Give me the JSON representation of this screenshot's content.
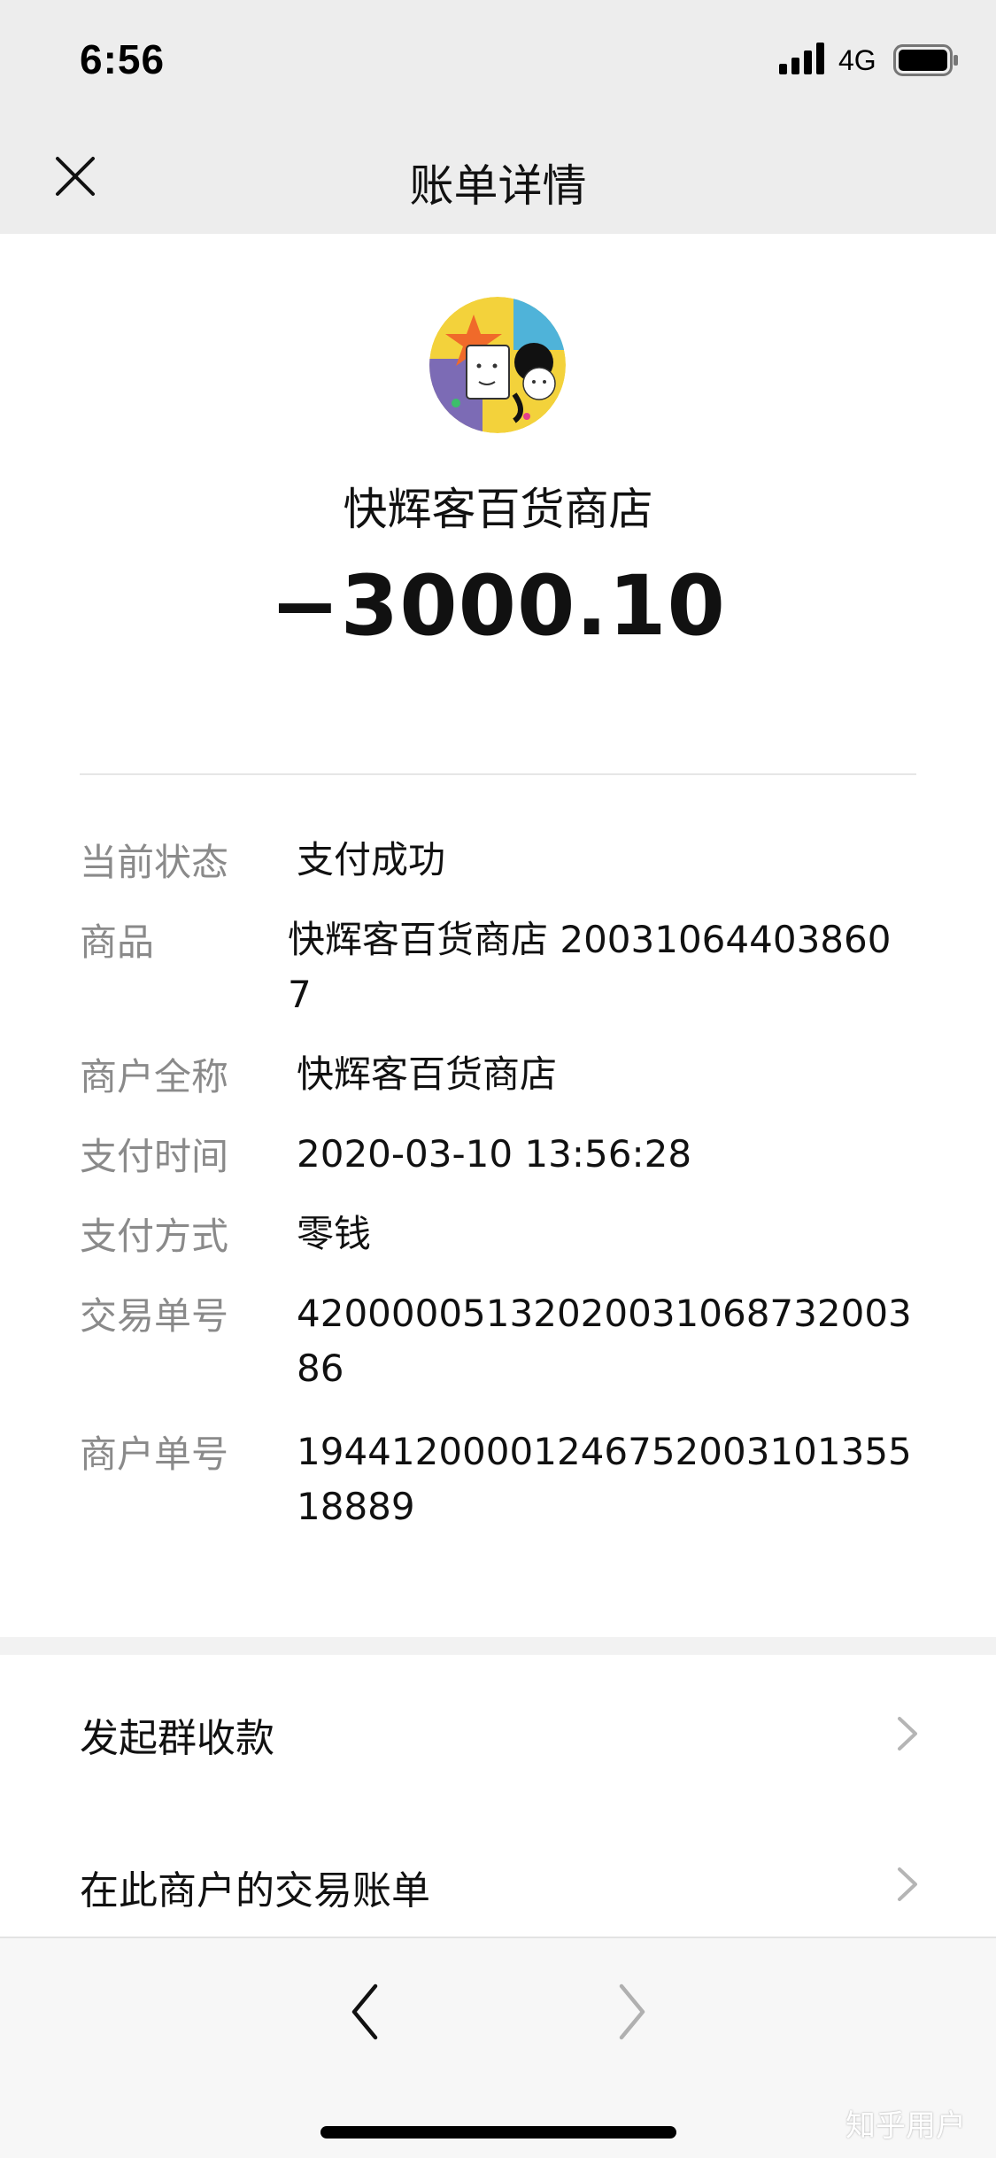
{
  "status_bar": {
    "time": "6:56",
    "network": "4G"
  },
  "nav": {
    "title": "账单详情",
    "close_icon": "close-icon"
  },
  "header": {
    "merchant_name": "快辉客百货商店",
    "amount": "−3000.10"
  },
  "details": [
    {
      "label": "当前状态",
      "value": "支付成功"
    },
    {
      "label": "商品",
      "value": "快辉客百货商店 200310644038607"
    },
    {
      "label": "商户全称",
      "value": "快辉客百货商店"
    },
    {
      "label": "支付时间",
      "value": "2020-03-10 13:56:28"
    },
    {
      "label": "支付方式",
      "value": "零钱"
    },
    {
      "label": "交易单号",
      "value": "4200000513202003106873200386"
    },
    {
      "label": "商户单号",
      "value": "1944120000124675200310135518889"
    }
  ],
  "actions": [
    {
      "label": "发起群收款"
    },
    {
      "label": "在此商户的交易账单"
    }
  ],
  "toolbar": {
    "back_icon": "chevron-left-icon",
    "forward_icon": "chevron-right-icon"
  },
  "watermark": "知乎用户",
  "colors": {
    "nav_background": "#ededed",
    "label_gray": "#8a8a8a",
    "text": "#111111"
  }
}
